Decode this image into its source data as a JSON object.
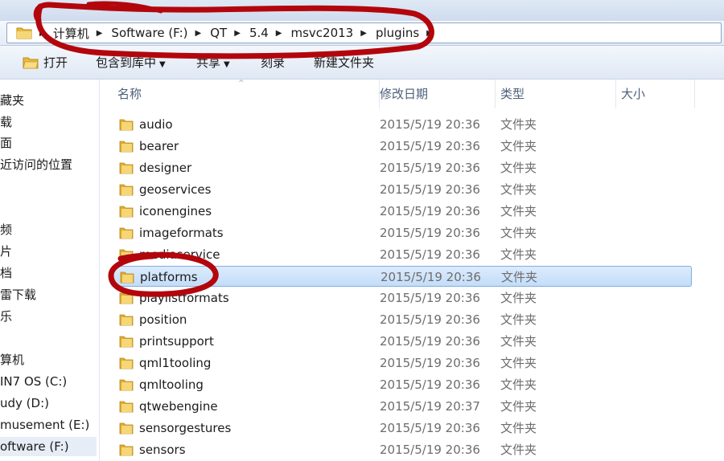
{
  "address": {
    "crumbs": [
      {
        "label": "计算机"
      },
      {
        "label": "Software (F:)"
      },
      {
        "label": "QT"
      },
      {
        "label": "5.4"
      },
      {
        "label": "msvc2013"
      },
      {
        "label": "plugins"
      }
    ]
  },
  "toolbar": {
    "open_label": "打开",
    "include_label": "包含到库中",
    "share_label": "共享",
    "burn_label": "刻录",
    "new_folder_label": "新建文件夹"
  },
  "nav": {
    "items": [
      {
        "label": "藏夹"
      },
      {
        "label": "载"
      },
      {
        "label": "面"
      },
      {
        "label": "近访问的位置"
      },
      {
        "label": "频"
      },
      {
        "label": "片"
      },
      {
        "label": "档"
      },
      {
        "label": "雷下载"
      },
      {
        "label": "乐"
      },
      {
        "label": "算机"
      },
      {
        "label": "IN7 OS  (C:)"
      },
      {
        "label": "udy (D:)"
      },
      {
        "label": "musement (E:)"
      },
      {
        "label": "oftware (F:)"
      }
    ],
    "selected_index": 13
  },
  "columns": {
    "name": "名称",
    "date": "修改日期",
    "type": "类型",
    "size": "大小"
  },
  "files": [
    {
      "name": "audio",
      "date": "2015/5/19 20:36",
      "type": "文件夹"
    },
    {
      "name": "bearer",
      "date": "2015/5/19 20:36",
      "type": "文件夹"
    },
    {
      "name": "designer",
      "date": "2015/5/19 20:36",
      "type": "文件夹"
    },
    {
      "name": "geoservices",
      "date": "2015/5/19 20:36",
      "type": "文件夹"
    },
    {
      "name": "iconengines",
      "date": "2015/5/19 20:36",
      "type": "文件夹"
    },
    {
      "name": "imageformats",
      "date": "2015/5/19 20:36",
      "type": "文件夹"
    },
    {
      "name": "mediaservice",
      "date": "2015/5/19 20:36",
      "type": "文件夹"
    },
    {
      "name": "platforms",
      "date": "2015/5/19 20:36",
      "type": "文件夹"
    },
    {
      "name": "playlistformats",
      "date": "2015/5/19 20:36",
      "type": "文件夹"
    },
    {
      "name": "position",
      "date": "2015/5/19 20:36",
      "type": "文件夹"
    },
    {
      "name": "printsupport",
      "date": "2015/5/19 20:36",
      "type": "文件夹"
    },
    {
      "name": "qml1tooling",
      "date": "2015/5/19 20:36",
      "type": "文件夹"
    },
    {
      "name": "qmltooling",
      "date": "2015/5/19 20:36",
      "type": "文件夹"
    },
    {
      "name": "qtwebengine",
      "date": "2015/5/19 20:37",
      "type": "文件夹"
    },
    {
      "name": "sensorgestures",
      "date": "2015/5/19 20:36",
      "type": "文件夹"
    },
    {
      "name": "sensors",
      "date": "2015/5/19 20:36",
      "type": "文件夹"
    }
  ],
  "selected_file_index": 7,
  "colors": {
    "annotation_red": "#b3060c",
    "selection_border": "#84acdd",
    "folder_yellow": "#f2c94c"
  }
}
